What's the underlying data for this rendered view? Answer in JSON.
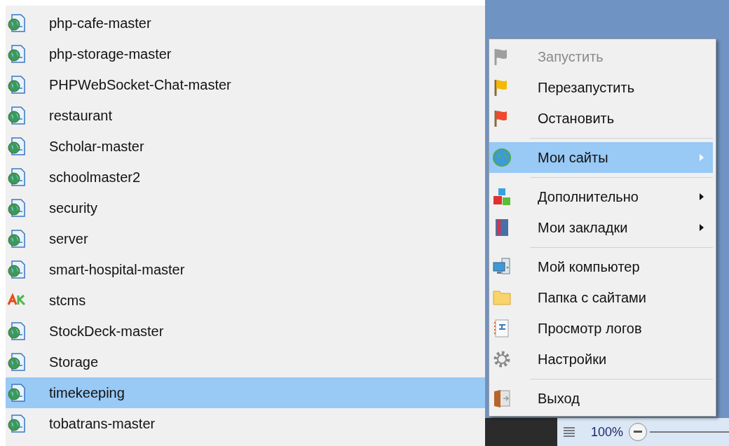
{
  "site_list": [
    {
      "name": "php-cafe-master",
      "kind": "site",
      "selected": false
    },
    {
      "name": "php-storage-master",
      "kind": "site",
      "selected": false
    },
    {
      "name": "PHPWebSocket-Chat-master",
      "kind": "site",
      "selected": false
    },
    {
      "name": "restaurant",
      "kind": "site",
      "selected": false
    },
    {
      "name": "Scholar-master",
      "kind": "site",
      "selected": false
    },
    {
      "name": "schoolmaster2",
      "kind": "site",
      "selected": false
    },
    {
      "name": "security",
      "kind": "site",
      "selected": false
    },
    {
      "name": "server",
      "kind": "site",
      "selected": false
    },
    {
      "name": "smart-hospital-master",
      "kind": "site",
      "selected": false
    },
    {
      "name": "stcms",
      "kind": "app",
      "selected": false
    },
    {
      "name": "StockDeck-master",
      "kind": "site",
      "selected": false
    },
    {
      "name": "Storage",
      "kind": "site",
      "selected": false
    },
    {
      "name": "timekeeping",
      "kind": "site",
      "selected": true
    },
    {
      "name": "tobatrans-master",
      "kind": "site",
      "selected": false
    }
  ],
  "context_menu": [
    {
      "kind": "item",
      "label": "Запустить",
      "disabled": true,
      "selected": false,
      "submenu": false
    },
    {
      "kind": "item",
      "label": "Перезапустить",
      "disabled": false,
      "selected": false,
      "submenu": false
    },
    {
      "kind": "item",
      "label": "Остановить",
      "disabled": false,
      "selected": false,
      "submenu": false
    },
    {
      "kind": "separator"
    },
    {
      "kind": "item",
      "label": "Мои сайты",
      "disabled": false,
      "selected": true,
      "submenu": true
    },
    {
      "kind": "separator"
    },
    {
      "kind": "item",
      "label": "Дополнительно",
      "disabled": false,
      "selected": false,
      "submenu": true
    },
    {
      "kind": "item",
      "label": "Мои закладки",
      "disabled": false,
      "selected": false,
      "submenu": true
    },
    {
      "kind": "separator"
    },
    {
      "kind": "item",
      "label": "Мой компьютер",
      "disabled": false,
      "selected": false,
      "submenu": false
    },
    {
      "kind": "item",
      "label": "Папка с сайтами",
      "disabled": false,
      "selected": false,
      "submenu": false
    },
    {
      "kind": "item",
      "label": "Просмотр логов",
      "disabled": false,
      "selected": false,
      "submenu": false
    },
    {
      "kind": "item",
      "label": "Настройки",
      "disabled": false,
      "selected": false,
      "submenu": false
    },
    {
      "kind": "separator"
    },
    {
      "kind": "item",
      "label": "Выход",
      "disabled": false,
      "selected": false,
      "submenu": false
    }
  ],
  "status_bar": {
    "zoom": "100%"
  }
}
